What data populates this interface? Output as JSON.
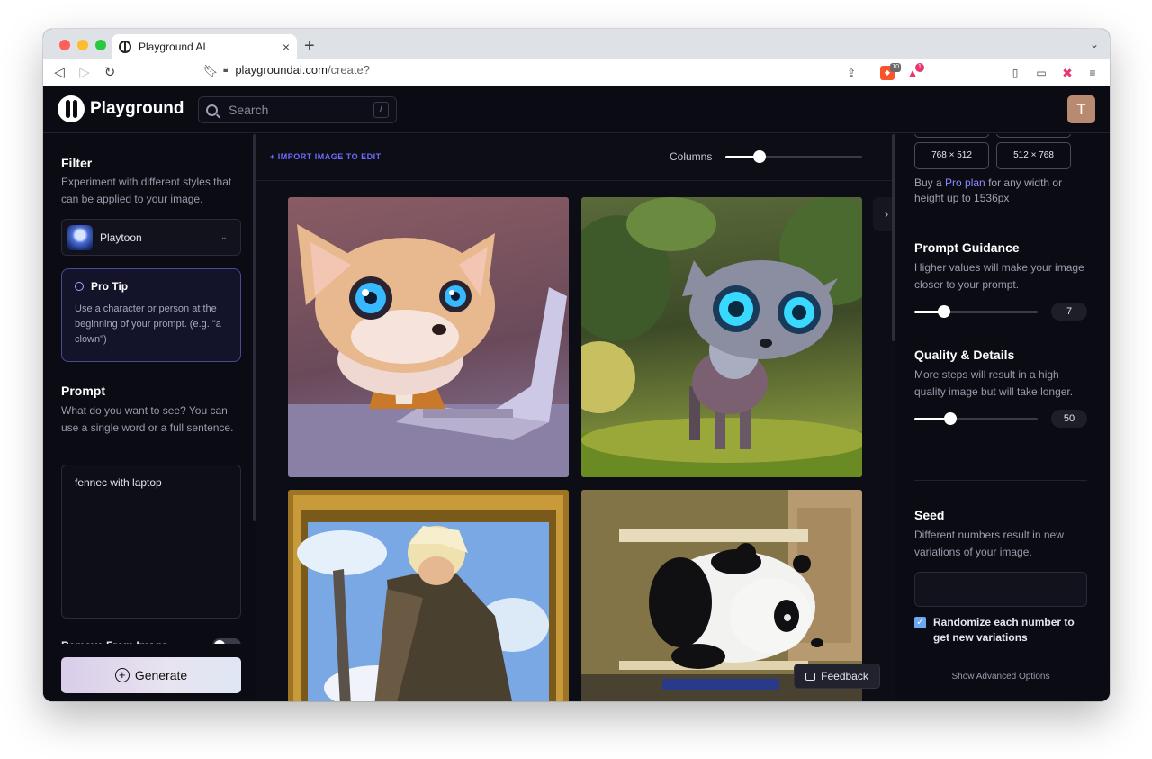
{
  "browser": {
    "tab_title": "Playground AI",
    "url_host": "playgroundai.com",
    "url_path": "/create?",
    "brave_badge": "10",
    "alert_badge": "1"
  },
  "header": {
    "logo_text": "Playground",
    "search_placeholder": "Search",
    "search_shortcut": "/",
    "avatar_initial": "T"
  },
  "left": {
    "filter_title": "Filter",
    "filter_desc": "Experiment with different styles that can be applied to your image.",
    "filter_selected": "Playtoon",
    "protip_title": "Pro Tip",
    "protip_text": "Use a character or person at the beginning of your prompt. (e.g. \"a clown\")",
    "prompt_title": "Prompt",
    "prompt_desc": "What do you want to see? You can use a single word or a full sentence.",
    "prompt_value": "fennec with laptop",
    "remove_label": "Remove From Image",
    "generate_label": "Generate"
  },
  "center": {
    "import_label": "+ IMPORT IMAGE TO EDIT",
    "columns_label": "Columns",
    "columns_level": 0.25,
    "feedback_label": "Feedback"
  },
  "right": {
    "dims": [
      "768 × 512",
      "512 × 768"
    ],
    "pro_text_before": "Buy a ",
    "pro_link": "Pro plan",
    "pro_text_after": " for any width or height up to 1536px",
    "guidance_title": "Prompt Guidance",
    "guidance_desc": "Higher values will make your image closer to your prompt.",
    "guidance_value": "7",
    "guidance_level": 0.24,
    "quality_title": "Quality & Details",
    "quality_desc": "More steps will result in a high quality image but will take longer.",
    "quality_value": "50",
    "quality_level": 0.29,
    "seed_title": "Seed",
    "seed_desc": "Different numbers result in new variations of your image.",
    "seed_value": "",
    "randomize_label": "Randomize each number to get new variations",
    "randomize_checked": true,
    "advanced_label": "Show Advanced Options"
  },
  "colors": {
    "accent": "#6d6dff",
    "background": "#0b0b14",
    "checkbox": "#6aa8f0"
  }
}
